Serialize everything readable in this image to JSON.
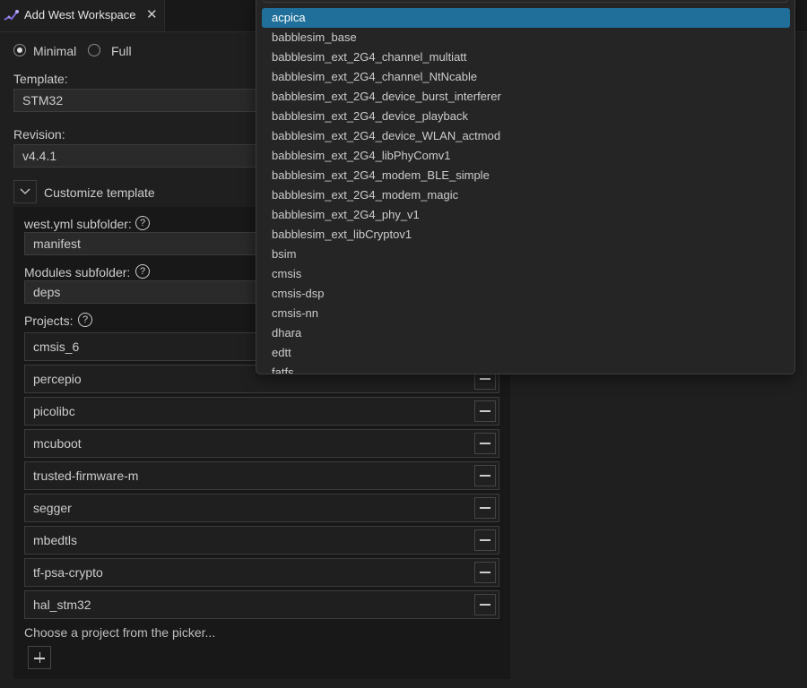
{
  "tab": {
    "title": "Add West Workspace",
    "close_icon": "close-icon"
  },
  "mode": {
    "options": [
      "Minimal",
      "Full"
    ],
    "selected": "Minimal"
  },
  "template": {
    "label": "Template:",
    "value": "STM32"
  },
  "revision": {
    "label": "Revision:",
    "value": "v4.4.1"
  },
  "customize": {
    "label": "Customize template",
    "expanded": true
  },
  "west_subfolder": {
    "label": "west.yml subfolder:",
    "value": "manifest",
    "help": "?"
  },
  "modules_subfolder": {
    "label": "Modules subfolder:",
    "value": "deps",
    "help": "?"
  },
  "projects": {
    "label": "Projects:",
    "help": "?",
    "items": [
      "cmsis_6",
      "percepio",
      "picolibc",
      "mcuboot",
      "trusted-firmware-m",
      "segger",
      "mbedtls",
      "tf-psa-crypto",
      "hal_stm32"
    ],
    "placeholder": "Choose a project from the picker..."
  },
  "picker": {
    "selected": "acpica",
    "items": [
      "acpica",
      "babblesim_base",
      "babblesim_ext_2G4_channel_multiatt",
      "babblesim_ext_2G4_channel_NtNcable",
      "babblesim_ext_2G4_device_burst_interferer",
      "babblesim_ext_2G4_device_playback",
      "babblesim_ext_2G4_device_WLAN_actmod",
      "babblesim_ext_2G4_libPhyComv1",
      "babblesim_ext_2G4_modem_BLE_simple",
      "babblesim_ext_2G4_modem_magic",
      "babblesim_ext_2G4_phy_v1",
      "babblesim_ext_libCryptov1",
      "bsim",
      "cmsis",
      "cmsis-dsp",
      "cmsis-nn",
      "dhara",
      "edtt",
      "fatfs"
    ]
  },
  "colors": {
    "accent": "#1f6f9a",
    "background": "#1f1f1f",
    "panel": "#181818"
  }
}
